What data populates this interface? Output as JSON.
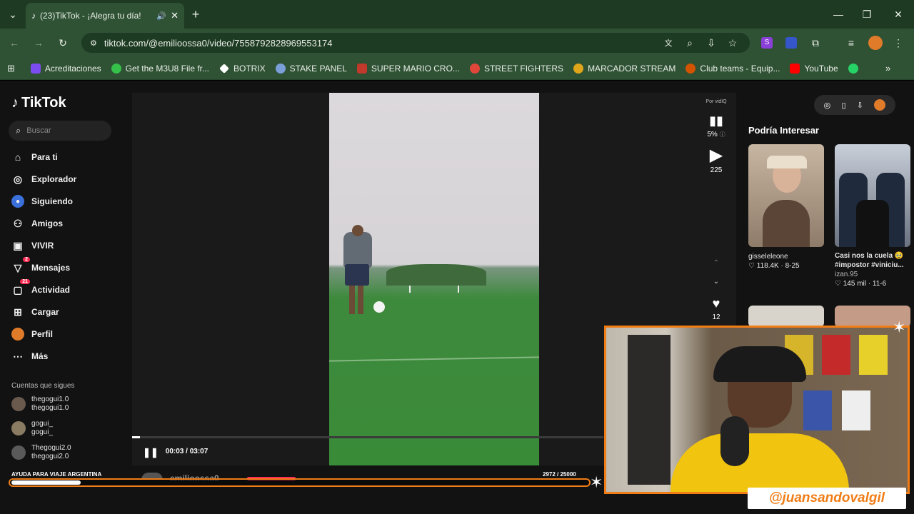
{
  "browser": {
    "tab_title": "(23)TikTok - ¡Alegra tu día!",
    "url": "tiktok.com/@emilioossa0/video/7558792828969553174",
    "bookmarks": [
      {
        "label": "Acreditaciones",
        "color": "#7b4cf0"
      },
      {
        "label": "Get the M3U8 File fr...",
        "color": "#35c04a"
      },
      {
        "label": "BOTRIX",
        "color": "#ffffff"
      },
      {
        "label": "STAKE PANEL",
        "color": "#7a9fd9"
      },
      {
        "label": "SUPER MARIO CRO...",
        "color": "#c0392b"
      },
      {
        "label": "STREET FIGHTERS",
        "color": "#e0473a"
      },
      {
        "label": "MARCADOR STREAM",
        "color": "#e0a51a"
      },
      {
        "label": "Club teams - Equip...",
        "color": "#d35400"
      },
      {
        "label": "YouTube",
        "color": "#ff0000"
      },
      {
        "label": "",
        "color": "#25d366"
      }
    ]
  },
  "sidebar": {
    "logo": "TikTok",
    "search_placeholder": "Buscar",
    "items": [
      {
        "label": "Para ti",
        "icon": "home-icon"
      },
      {
        "label": "Explorador",
        "icon": "compass-icon"
      },
      {
        "label": "Siguiendo",
        "icon": "following-icon"
      },
      {
        "label": "Amigos",
        "icon": "friends-icon"
      },
      {
        "label": "VIVIR",
        "icon": "live-icon"
      },
      {
        "label": "Mensajes",
        "icon": "messages-icon",
        "badge": "2"
      },
      {
        "label": "Actividad",
        "icon": "activity-icon",
        "badge": "21"
      },
      {
        "label": "Cargar",
        "icon": "upload-icon"
      },
      {
        "label": "Perfil",
        "icon": "profile-icon"
      },
      {
        "label": "Más",
        "icon": "more-icon"
      }
    ],
    "following_title": "Cuentas que sigues",
    "following": [
      {
        "name": "thegogui1.0",
        "handle": "thegogui1.0"
      },
      {
        "name": "gogui_",
        "handle": "gogui_"
      },
      {
        "name": "Thegogui2.0",
        "handle": "thegogui2.0"
      }
    ]
  },
  "video": {
    "time": "00:03 / 03:07",
    "progress": 0.016,
    "author": "emilioossa0",
    "promo_label": "Por vidIQ",
    "score_percent": "5%",
    "play_count": "225",
    "like_count": "12"
  },
  "recommend": {
    "title": "Podría Interesar",
    "cards": [
      {
        "author": "gisseleleone",
        "stats": "118.4K · 8-25",
        "caption": ""
      },
      {
        "author": "izan.95",
        "stats": "145 mil · 11-6",
        "caption": "Casi nos la cuela 🥹 #impostor #viniciu..."
      }
    ]
  },
  "stream_overlay": {
    "goal_label": "AYUDA PARA VIAJE ARGENTINA",
    "goal_count": "2972  / 25000",
    "goal_progress": 0.119,
    "handle": "@juansandovalgil"
  }
}
